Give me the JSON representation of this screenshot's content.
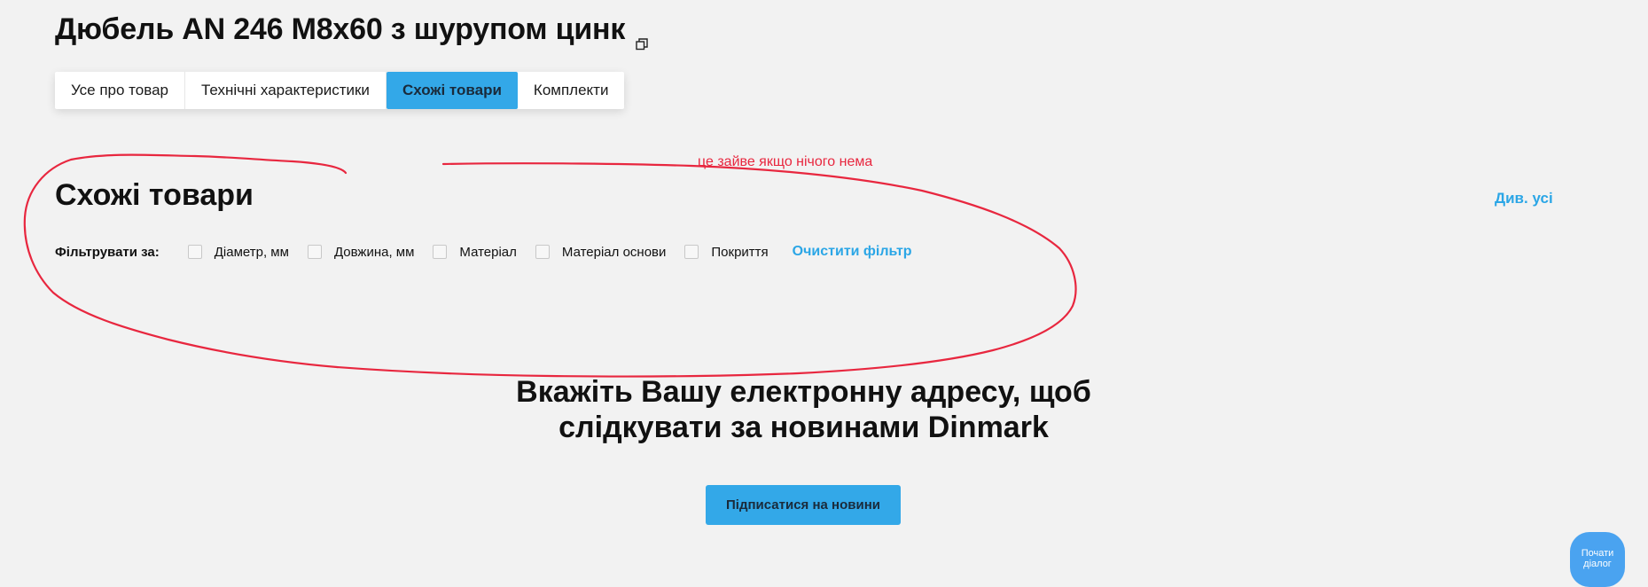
{
  "product": {
    "title": "Дюбель AN 246 M8x60 з шурупом цинк",
    "copy_icon": "copy-icon"
  },
  "tabs": [
    {
      "label": "Усе про товар",
      "active": false
    },
    {
      "label": "Технічні характеристики",
      "active": false
    },
    {
      "label": "Схожі товари",
      "active": true
    },
    {
      "label": "Комплекти",
      "active": false
    }
  ],
  "similar": {
    "title": "Схожі товари",
    "see_all": "Див. усі",
    "filter_label": "Фільтрувати за:",
    "filters": [
      "Діаметр, мм",
      "Довжина, мм",
      "Матеріал",
      "Матеріал основи",
      "Покриття"
    ],
    "clear_filter": "Очистити фільтр"
  },
  "annotation": {
    "text": "це зайве якщо нічого нема",
    "color": "#e8273f"
  },
  "newsletter": {
    "title_line1": "Вкажіть Вашу електронну адресу, щоб",
    "title_line2": "слідкувати за новинами Dinmark",
    "button": "Підписатися на новини"
  },
  "chat": {
    "line1": "Почати",
    "line2": "діалог"
  },
  "colors": {
    "accent": "#33a8e8",
    "link": "#2ba6e6",
    "background": "#f2f2f2"
  }
}
